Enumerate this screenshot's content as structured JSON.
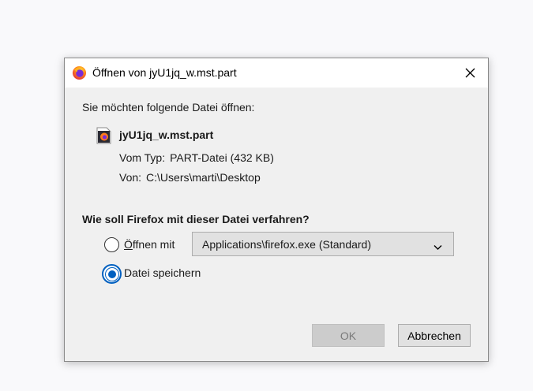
{
  "dialog": {
    "title": "Öffnen von jyU1jq_w.mst.part",
    "prompt": "Sie möchten folgende Datei öffnen:",
    "file": {
      "name": "jyU1jq_w.mst.part",
      "type_label": "Vom Typ:",
      "type_value": "PART-Datei (432 KB)",
      "from_label": "Von:",
      "from_value": "C:\\Users\\marti\\Desktop"
    },
    "question": "Wie soll Firefox mit dieser Datei verfahren?",
    "option_open": {
      "accel": "Ö",
      "rest": "ffnen mit",
      "selected": false
    },
    "app_select": {
      "value": "Applications\\firefox.exe (Standard)"
    },
    "option_save": {
      "label": "Datei speichern",
      "selected": true
    },
    "buttons": {
      "ok": "OK",
      "cancel": "Abbrechen"
    },
    "icons": {
      "title": "firefox-icon",
      "close": "close-icon",
      "file": "file-icon",
      "dropdown": "chevron-down-icon"
    },
    "accent_color": "#0060c0"
  }
}
